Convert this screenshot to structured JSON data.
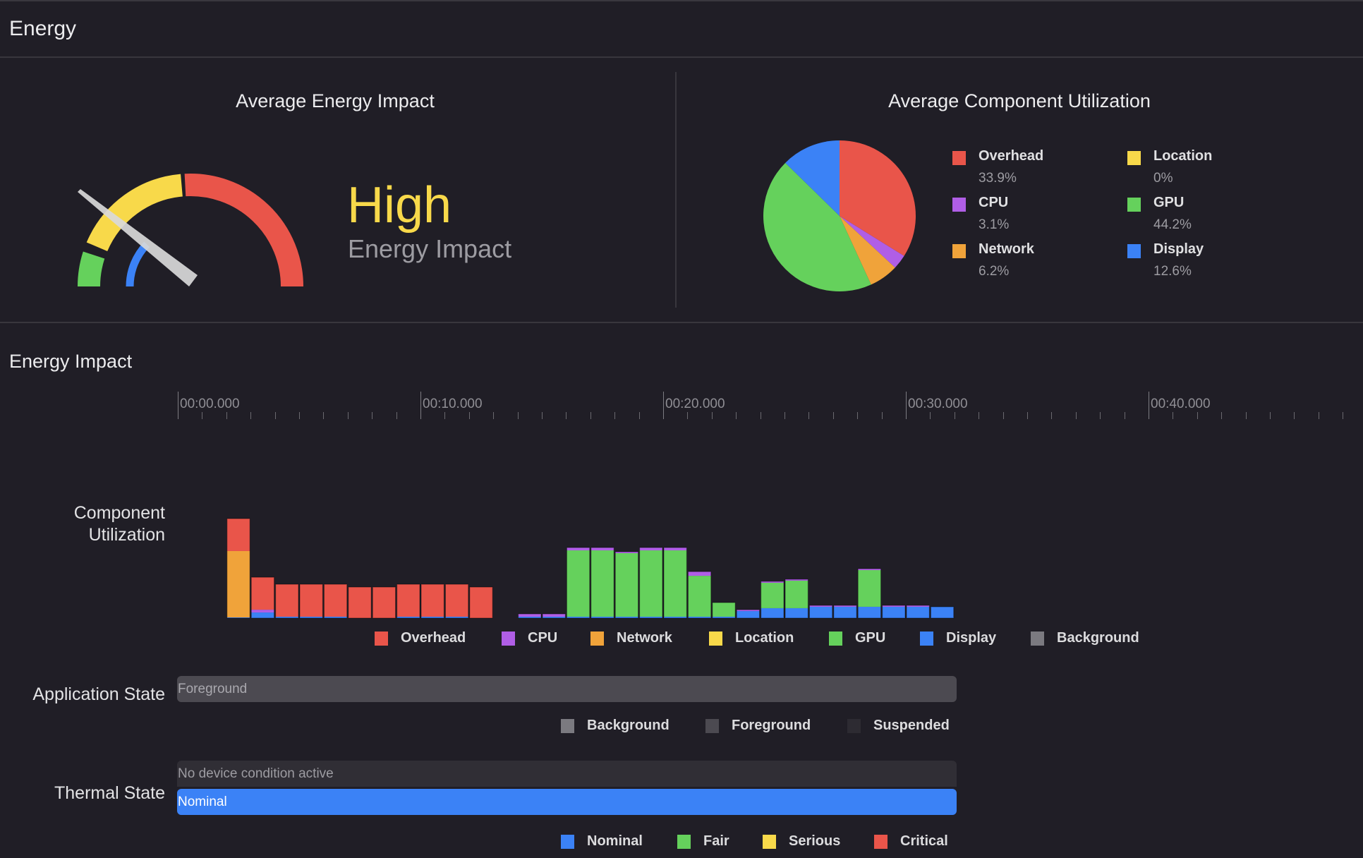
{
  "page": {
    "title": "Energy"
  },
  "average_energy_impact": {
    "title": "Average Energy Impact",
    "level": "High",
    "subtitle": "Energy Impact",
    "gauge_segments": [
      {
        "name": "Low",
        "color": "#65d15c"
      },
      {
        "name": "High",
        "color": "#f8d94a"
      },
      {
        "name": "Very High",
        "color": "#e9554a"
      },
      {
        "name": "Current",
        "color": "#3b82f6"
      }
    ],
    "needle_color": "#d9d9d9"
  },
  "average_component_utilization": {
    "title": "Average Component Utilization",
    "legend": [
      {
        "label": "Overhead",
        "value": "33.9%",
        "color": "#e9554a"
      },
      {
        "label": "Location",
        "value": "0%",
        "color": "#f8d94a"
      },
      {
        "label": "CPU",
        "value": "3.1%",
        "color": "#b05ee6"
      },
      {
        "label": "GPU",
        "value": "44.2%",
        "color": "#65d15c"
      },
      {
        "label": "Network",
        "value": "6.2%",
        "color": "#f0a33a"
      },
      {
        "label": "Display",
        "value": "12.6%",
        "color": "#3b82f6"
      }
    ]
  },
  "energy_impact": {
    "title": "Energy Impact",
    "timeline": {
      "major_labels": [
        "00:00.000",
        "00:10.000",
        "00:20.000",
        "00:30.000",
        "00:40.000"
      ],
      "seconds_per_major": 10,
      "minor_per_major": 10,
      "range_seconds": [
        0,
        48.5
      ]
    },
    "component_utilization_label": "Component Utilization",
    "component_legend": [
      {
        "label": "Overhead",
        "color": "#e9554a"
      },
      {
        "label": "CPU",
        "color": "#b05ee6"
      },
      {
        "label": "Network",
        "color": "#f0a33a"
      },
      {
        "label": "Location",
        "color": "#f8d94a"
      },
      {
        "label": "GPU",
        "color": "#65d15c"
      },
      {
        "label": "Display",
        "color": "#3b82f6"
      },
      {
        "label": "Background",
        "color": "#7b7a80"
      }
    ],
    "application_state": {
      "label": "Application State",
      "bar_text": "Foreground",
      "legend": [
        {
          "label": "Background",
          "color": "#7b7a80"
        },
        {
          "label": "Foreground",
          "color": "#4c4a51"
        },
        {
          "label": "Suspended",
          "color": "#2d2b32"
        }
      ]
    },
    "thermal_state": {
      "label": "Thermal State",
      "condition_text": "No device condition active",
      "state_text": "Nominal",
      "legend": [
        {
          "label": "Nominal",
          "color": "#3b82f6"
        },
        {
          "label": "Fair",
          "color": "#65d15c"
        },
        {
          "label": "Serious",
          "color": "#f8d94a"
        },
        {
          "label": "Critical",
          "color": "#e9554a"
        }
      ]
    }
  },
  "chart_data": [
    {
      "type": "pie",
      "title": "Average Component Utilization",
      "categories": [
        "Overhead",
        "CPU",
        "Network",
        "Location",
        "GPU",
        "Display"
      ],
      "values": [
        33.9,
        3.1,
        6.2,
        0,
        44.2,
        12.6
      ],
      "colors": [
        "#e9554a",
        "#b05ee6",
        "#f0a33a",
        "#f8d94a",
        "#65d15c",
        "#3b82f6"
      ],
      "legend": "right"
    },
    {
      "type": "bar",
      "stacked": true,
      "title": "Component Utilization",
      "xlabel": "time",
      "x_unit": "seconds",
      "x": [
        2,
        3,
        4,
        5,
        6,
        7,
        8,
        9,
        10,
        11,
        12,
        14,
        15,
        16,
        17,
        18,
        19,
        20,
        21,
        22,
        23,
        24,
        25,
        26,
        27,
        28,
        29,
        30,
        31
      ],
      "xlim": [
        0,
        48.5
      ],
      "ylim": [
        0,
        100
      ],
      "series": [
        {
          "name": "Display",
          "color": "#3b82f6",
          "values": [
            0.7,
            5.6,
            1.4,
            1.4,
            1.4,
            0,
            0,
            1.4,
            1.4,
            1.4,
            0,
            1.4,
            1.4,
            1.4,
            1.4,
            1.4,
            1.4,
            1.4,
            1.4,
            1.4,
            7,
            9.9,
            9.9,
            11.3,
            11.3,
            11.3,
            11.3,
            11.3,
            11.3
          ]
        },
        {
          "name": "Network",
          "color": "#f0a33a",
          "values": [
            66.2,
            0,
            0,
            0,
            0,
            0,
            0,
            0,
            0,
            0,
            0,
            0,
            0,
            0,
            0,
            0,
            0,
            0,
            0,
            0,
            0,
            0,
            0,
            0,
            0,
            0,
            0,
            0,
            0
          ]
        },
        {
          "name": "GPU",
          "color": "#65d15c",
          "values": [
            0,
            0,
            0,
            0,
            0,
            0,
            0,
            0,
            0,
            0,
            0,
            0,
            0,
            66.2,
            66.2,
            63.4,
            66.2,
            66.2,
            40.8,
            14.1,
            0,
            25.4,
            27.5,
            0,
            0,
            36.6,
            0,
            0,
            0
          ]
        },
        {
          "name": "CPU",
          "color": "#b05ee6",
          "values": [
            0,
            2.8,
            0,
            0,
            0,
            0,
            0,
            0,
            0,
            0,
            0,
            2.8,
            2.8,
            2.8,
            2.8,
            1.4,
            2.8,
            2.8,
            4.2,
            0,
            1.4,
            1.4,
            1.4,
            1.4,
            1.4,
            1.4,
            1.4,
            1.4,
            0
          ]
        },
        {
          "name": "Overhead",
          "color": "#e9554a",
          "values": [
            32.4,
            32.4,
            32.4,
            32.4,
            32.4,
            31,
            31,
            32.4,
            32.4,
            32.4,
            31,
            0,
            0,
            0,
            0,
            0,
            0,
            0,
            0,
            0,
            0,
            0,
            0,
            0,
            0,
            0,
            0,
            0,
            0
          ]
        },
        {
          "name": "Location",
          "color": "#f8d94a",
          "values": [
            0,
            0,
            0,
            0,
            0,
            0,
            0,
            0,
            0,
            0,
            0,
            0,
            0,
            0,
            0,
            0,
            0,
            0,
            0,
            0,
            0,
            0,
            0,
            0,
            0,
            0,
            0,
            0,
            0
          ]
        }
      ]
    }
  ]
}
